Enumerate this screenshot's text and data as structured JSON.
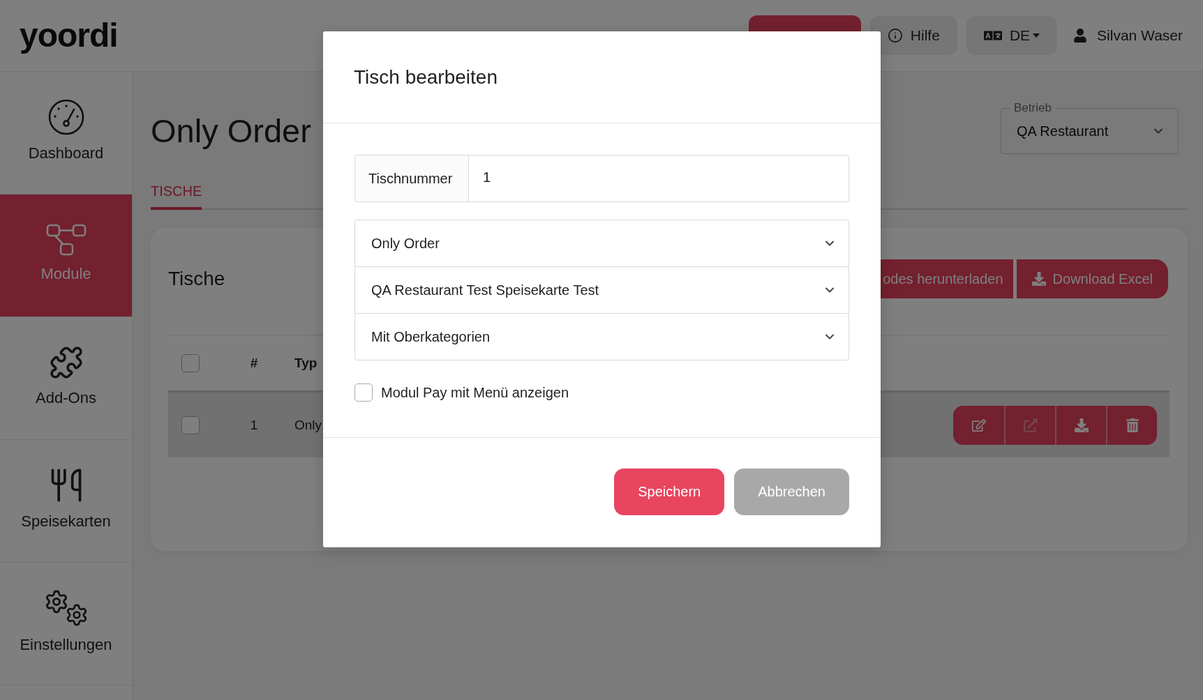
{
  "header": {
    "logo": "yoordi",
    "actions": [
      {
        "kind": "primary"
      },
      {
        "kind": "help",
        "label": "Hilfe"
      },
      {
        "kind": "language",
        "label": "DE"
      }
    ],
    "user": {
      "name": "Silvan Waser"
    }
  },
  "sidebar": {
    "items": [
      {
        "label": "Dashboard",
        "selected": false
      },
      {
        "label": "Module",
        "selected": true
      },
      {
        "label": "Add-Ons",
        "selected": false
      },
      {
        "label": "Speisekarten",
        "selected": false
      },
      {
        "label": "Einstellungen",
        "selected": false
      }
    ]
  },
  "page": {
    "title": "Only Order",
    "business_select": {
      "label": "Betrieb",
      "value": "QA Restaurant"
    },
    "tabs": [
      {
        "label": "TISCHE",
        "selected": true
      }
    ],
    "card": {
      "title": "Tische",
      "buttons": [
        {
          "kind": "plain",
          "label": "odes herunterladen"
        },
        {
          "kind": "download",
          "label": "Download Excel"
        }
      ],
      "table": {
        "select_all_checked": false,
        "columns": [
          "#",
          "Typ"
        ],
        "rows": [
          {
            "checked": false,
            "highlighted": true,
            "cells": [
              "1",
              "Only"
            ],
            "actions": [
              {
                "disabled": false
              },
              {
                "disabled": true
              },
              {
                "disabled": false
              },
              {
                "disabled": false
              }
            ]
          }
        ]
      }
    }
  },
  "modal": {
    "title": "Tisch bearbeiten",
    "table_number": {
      "label": "Tischnummer",
      "value": "1"
    },
    "selects": [
      {
        "value": "Only Order"
      },
      {
        "value": "QA Restaurant Test Speisekarte Test"
      },
      {
        "value": "Mit Oberkategorien"
      }
    ],
    "checkbox": {
      "label": "Modul Pay mit Menü anzeigen",
      "checked": false
    },
    "buttons": [
      {
        "kind": "primary",
        "label": "Speichern"
      },
      {
        "kind": "secondary",
        "label": "Abbrechen"
      }
    ]
  }
}
